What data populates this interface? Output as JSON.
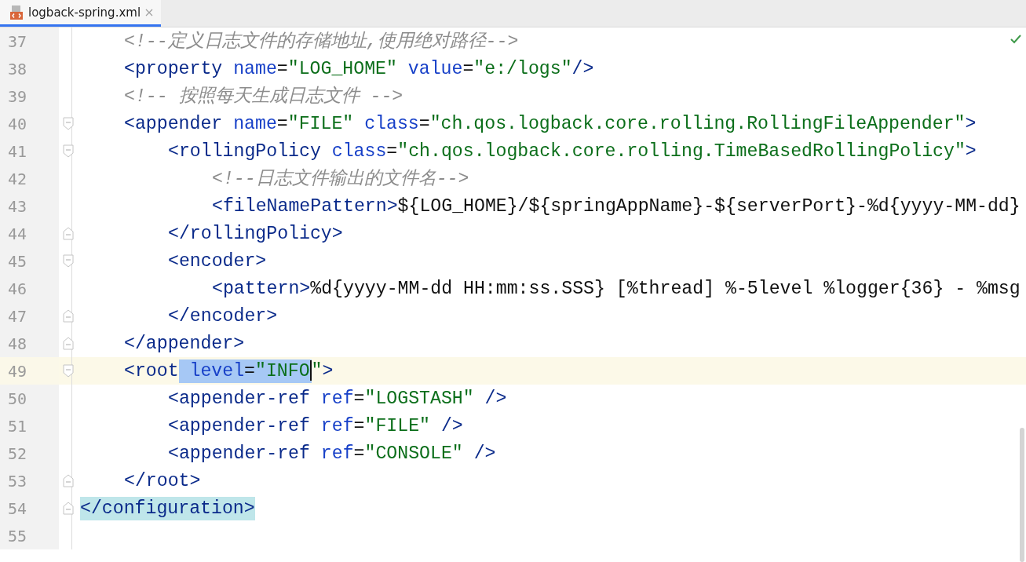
{
  "tab": {
    "label": "logback-spring.xml",
    "selected": true
  },
  "lines": [
    {
      "number": "37",
      "current": false,
      "fold_start": false,
      "fold_end": false,
      "tokens": [
        {
          "kind": "comment",
          "text": "    <!--定义日志文件的存储地址,使用绝对路径-->"
        }
      ]
    },
    {
      "number": "38",
      "current": false,
      "fold_start": false,
      "fold_end": false,
      "tokens": [
        {
          "kind": "tag",
          "text": "    <property"
        },
        {
          "kind": "attr",
          "text": " name"
        },
        {
          "kind": "plain",
          "text": "="
        },
        {
          "kind": "value",
          "text": "\"LOG_HOME\""
        },
        {
          "kind": "attr",
          "text": " value"
        },
        {
          "kind": "plain",
          "text": "="
        },
        {
          "kind": "value",
          "text": "\"e:/logs\""
        },
        {
          "kind": "tag",
          "text": "/>"
        }
      ]
    },
    {
      "number": "39",
      "current": false,
      "fold_start": false,
      "fold_end": false,
      "tokens": [
        {
          "kind": "comment",
          "text": "    <!-- 按照每天生成日志文件 -->"
        }
      ]
    },
    {
      "number": "40",
      "current": false,
      "fold_start": true,
      "fold_end": false,
      "tokens": [
        {
          "kind": "tag",
          "text": "    <appender"
        },
        {
          "kind": "attr",
          "text": " name"
        },
        {
          "kind": "plain",
          "text": "="
        },
        {
          "kind": "value",
          "text": "\"FILE\""
        },
        {
          "kind": "attr",
          "text": " class"
        },
        {
          "kind": "plain",
          "text": "="
        },
        {
          "kind": "value",
          "text": "\"ch.qos.logback.core.rolling.RollingFileAppender\""
        },
        {
          "kind": "tag",
          "text": ">"
        }
      ]
    },
    {
      "number": "41",
      "current": false,
      "fold_start": true,
      "fold_end": false,
      "tokens": [
        {
          "kind": "tag",
          "text": "        <rollingPolicy"
        },
        {
          "kind": "attr",
          "text": " class"
        },
        {
          "kind": "plain",
          "text": "="
        },
        {
          "kind": "value",
          "text": "\"ch.qos.logback.core.rolling.TimeBasedRollingPolicy\""
        },
        {
          "kind": "tag",
          "text": ">"
        }
      ]
    },
    {
      "number": "42",
      "current": false,
      "fold_start": false,
      "fold_end": false,
      "tokens": [
        {
          "kind": "comment",
          "text": "            <!--日志文件输出的文件名-->"
        }
      ]
    },
    {
      "number": "43",
      "current": false,
      "fold_start": false,
      "fold_end": false,
      "tokens": [
        {
          "kind": "tag",
          "text": "            <fileNamePattern>"
        },
        {
          "kind": "plain",
          "text": "${LOG_HOME}/${springAppName}-${serverPort}-%d{yyyy-MM-dd}"
        }
      ]
    },
    {
      "number": "44",
      "current": false,
      "fold_start": false,
      "fold_end": true,
      "tokens": [
        {
          "kind": "tag",
          "text": "        </rollingPolicy>"
        }
      ]
    },
    {
      "number": "45",
      "current": false,
      "fold_start": true,
      "fold_end": false,
      "tokens": [
        {
          "kind": "tag",
          "text": "        <encoder>"
        }
      ]
    },
    {
      "number": "46",
      "current": false,
      "fold_start": false,
      "fold_end": false,
      "tokens": [
        {
          "kind": "tag",
          "text": "            <pattern>"
        },
        {
          "kind": "plain",
          "text": "%d{yyyy-MM-dd HH:mm:ss.SSS} [%thread] %-5level %logger{36} - %msg"
        }
      ]
    },
    {
      "number": "47",
      "current": false,
      "fold_start": false,
      "fold_end": true,
      "tokens": [
        {
          "kind": "tag",
          "text": "        </encoder>"
        }
      ]
    },
    {
      "number": "48",
      "current": false,
      "fold_start": false,
      "fold_end": true,
      "tokens": [
        {
          "kind": "tag",
          "text": "    </appender>"
        }
      ]
    },
    {
      "number": "49",
      "current": true,
      "fold_start": true,
      "fold_end": false,
      "tokens": [
        {
          "kind": "tag",
          "text": "    <root",
          "selected": false
        },
        {
          "kind": "attr",
          "text": " level",
          "selected": true
        },
        {
          "kind": "plain",
          "text": "=",
          "selected": true
        },
        {
          "kind": "value",
          "text": "\"INFO",
          "selected": true,
          "caret": true
        },
        {
          "kind": "value",
          "text": "\"",
          "selected": false
        },
        {
          "kind": "tag",
          "text": ">",
          "selected": false
        }
      ]
    },
    {
      "number": "50",
      "current": false,
      "fold_start": false,
      "fold_end": false,
      "tokens": [
        {
          "kind": "tag",
          "text": "        <appender-ref"
        },
        {
          "kind": "attr",
          "text": " ref"
        },
        {
          "kind": "plain",
          "text": "="
        },
        {
          "kind": "value",
          "text": "\"LOGSTASH\""
        },
        {
          "kind": "tag",
          "text": " />"
        }
      ]
    },
    {
      "number": "51",
      "current": false,
      "fold_start": false,
      "fold_end": false,
      "tokens": [
        {
          "kind": "tag",
          "text": "        <appender-ref"
        },
        {
          "kind": "attr",
          "text": " ref"
        },
        {
          "kind": "plain",
          "text": "="
        },
        {
          "kind": "value",
          "text": "\"FILE\""
        },
        {
          "kind": "tag",
          "text": " />"
        }
      ]
    },
    {
      "number": "52",
      "current": false,
      "fold_start": false,
      "fold_end": false,
      "tokens": [
        {
          "kind": "tag",
          "text": "        <appender-ref"
        },
        {
          "kind": "attr",
          "text": " ref"
        },
        {
          "kind": "plain",
          "text": "="
        },
        {
          "kind": "value",
          "text": "\"CONSOLE\""
        },
        {
          "kind": "tag",
          "text": " />"
        }
      ]
    },
    {
      "number": "53",
      "current": false,
      "fold_start": false,
      "fold_end": true,
      "tokens": [
        {
          "kind": "tag",
          "text": "    </root>"
        }
      ]
    },
    {
      "number": "54",
      "current": false,
      "fold_start": false,
      "fold_end": true,
      "tokens": [
        {
          "kind": "tag",
          "text": "</configuration>",
          "matched": true
        }
      ]
    },
    {
      "number": "55",
      "current": false,
      "fold_start": false,
      "fold_end": false
    }
  ]
}
